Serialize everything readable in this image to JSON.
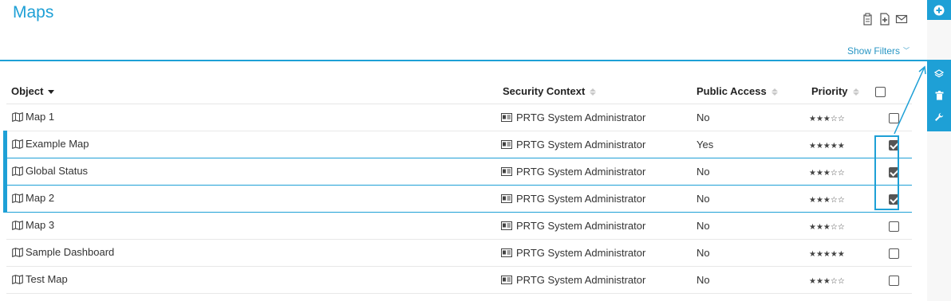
{
  "page": {
    "title": "Maps"
  },
  "toolbar": {
    "icons": [
      "clipboard-icon",
      "add-document-icon",
      "email-icon"
    ],
    "show_filters": "Show Filters"
  },
  "side_toolbar": {
    "buttons": [
      "add-icon",
      "layers-icon",
      "trash-icon",
      "wrench-icon"
    ],
    "accent": "#1ea0d6"
  },
  "table": {
    "columns": {
      "object": "Object",
      "security_context": "Security Context",
      "public_access": "Public Access",
      "priority": "Priority"
    },
    "rows": [
      {
        "name": "Map 1",
        "context": "PRTG System Administrator",
        "public": "No",
        "priority": "★★★☆☆",
        "priority_value": 3,
        "checked": false
      },
      {
        "name": "Example Map",
        "context": "PRTG System Administrator",
        "public": "Yes",
        "priority": "★★★★★",
        "priority_value": 5,
        "checked": true
      },
      {
        "name": "Global Status",
        "context": "PRTG System Administrator",
        "public": "No",
        "priority": "★★★☆☆",
        "priority_value": 3,
        "checked": true
      },
      {
        "name": "Map 2",
        "context": "PRTG System Administrator",
        "public": "No",
        "priority": "★★★☆☆",
        "priority_value": 3,
        "checked": true
      },
      {
        "name": "Map 3",
        "context": "PRTG System Administrator",
        "public": "No",
        "priority": "★★★☆☆",
        "priority_value": 3,
        "checked": false
      },
      {
        "name": "Sample Dashboard",
        "context": "PRTG System Administrator",
        "public": "No",
        "priority": "★★★★★",
        "priority_value": 5,
        "checked": false
      },
      {
        "name": "Test Map",
        "context": "PRTG System Administrator",
        "public": "No",
        "priority": "★★★☆☆",
        "priority_value": 3,
        "checked": false
      }
    ]
  }
}
